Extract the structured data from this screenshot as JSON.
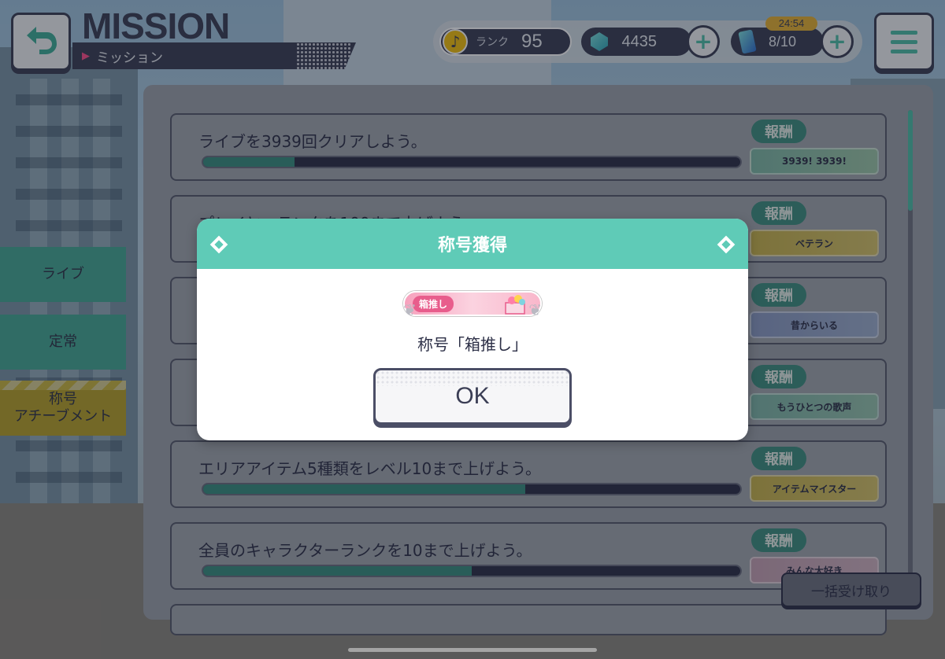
{
  "header": {
    "title": "MISSION",
    "subtitle": "ミッション",
    "rank_label": "ランク",
    "rank_value": "95",
    "gems": "4435",
    "tickets": "8/10",
    "timer": "24:54"
  },
  "tabs": [
    {
      "label": "ライブ"
    },
    {
      "label": "定常"
    },
    {
      "label": "称号\nアチーブメント"
    }
  ],
  "missions": [
    {
      "text": "ライブを3939回クリアしよう。",
      "progress": 0.17,
      "reward_label": "報酬",
      "badge": "3939!  3939!"
    },
    {
      "text": "プレイヤーランクを100まで上げよう。",
      "progress": 0.95,
      "reward_label": "報酬",
      "badge": "ベテラン"
    },
    {
      "text": "",
      "progress": 0.5,
      "reward_label": "報酬",
      "badge": "昔からいる"
    },
    {
      "text": "",
      "progress": 0.5,
      "reward_label": "報酬",
      "badge": "もうひとつの歌声"
    },
    {
      "text": "エリアアイテム5種類をレベル10まで上げよう。",
      "progress": 0.6,
      "reward_label": "報酬",
      "badge": "アイテムマイスター"
    },
    {
      "text": "全員のキャラクターランクを10まで上げよう。",
      "progress": 0.5,
      "reward_label": "報酬",
      "badge": "みんな大好き"
    }
  ],
  "bulk_receive": "一括受け取り",
  "modal": {
    "title": "称号獲得",
    "plate_label": "箱推し",
    "award_text": "称号「箱推し」",
    "ok": "OK"
  },
  "colors": {
    "accent": "#5fcbb7",
    "dark": "#3b3e55",
    "pink": "#ff4f8b",
    "yellow": "#e7b232"
  }
}
